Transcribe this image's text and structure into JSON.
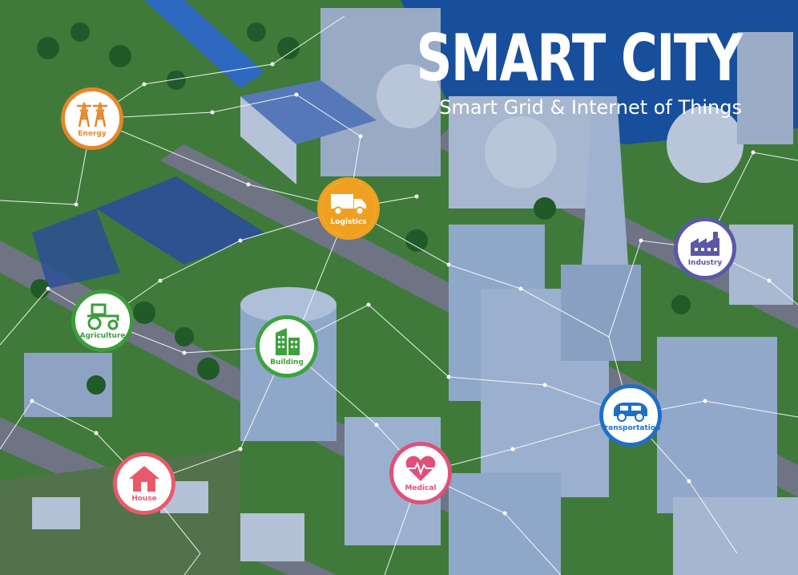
{
  "title": "SMART CITY",
  "subtitle": "Smart Grid & Internet of Things",
  "colors": {
    "sky": "#174f9c",
    "grass": "#3f7a3a",
    "road": "#6f7484",
    "building": "#8fa7c9",
    "network": "#ffffff"
  },
  "badges": [
    {
      "id": "energy",
      "label": "Energy",
      "icon": "power-tower-icon",
      "color": "#e8862a"
    },
    {
      "id": "logistics",
      "label": "Logistics",
      "icon": "truck-icon",
      "color": "#f0a020"
    },
    {
      "id": "agriculture",
      "label": "Agriculture",
      "icon": "tractor-icon",
      "color": "#3c9c3c"
    },
    {
      "id": "building",
      "label": "Building",
      "icon": "office-building-icon",
      "color": "#3fa13f"
    },
    {
      "id": "industry",
      "label": "Industry",
      "icon": "factory-icon",
      "color": "#5b58a8"
    },
    {
      "id": "transportation",
      "label": "Transportation",
      "icon": "car-icon",
      "color": "#1f6fc7"
    },
    {
      "id": "medical",
      "label": "Medical",
      "icon": "heartbeat-icon",
      "color": "#e0507a"
    },
    {
      "id": "house",
      "label": "House",
      "icon": "house-icon",
      "color": "#e85a6a"
    }
  ]
}
